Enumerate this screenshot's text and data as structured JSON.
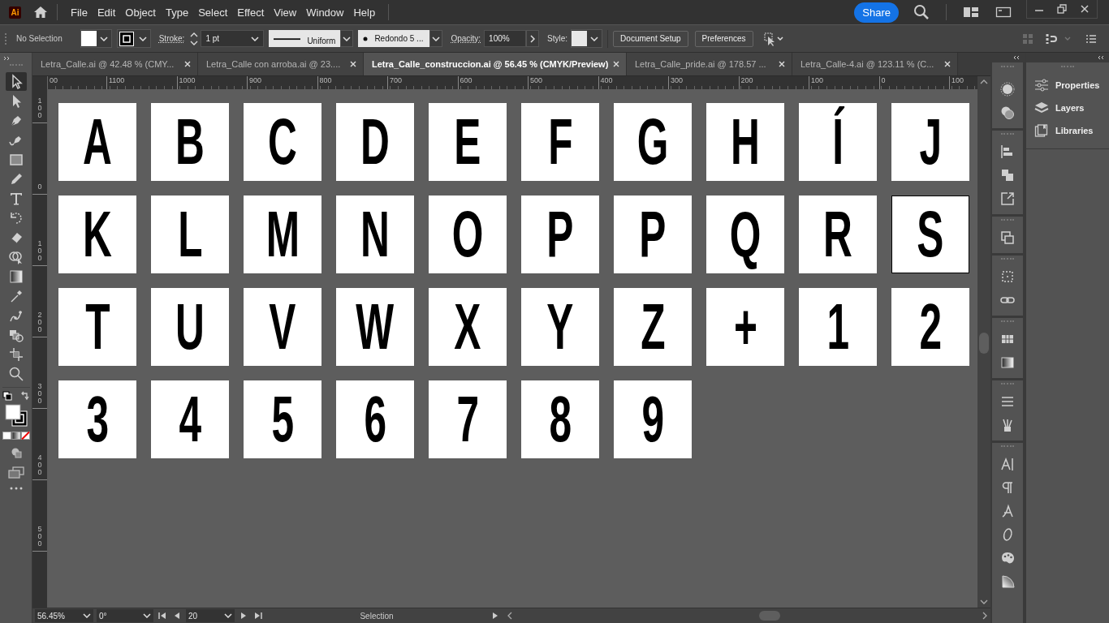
{
  "logo": "Ai",
  "menu": [
    "File",
    "Edit",
    "Object",
    "Type",
    "Select",
    "Effect",
    "View",
    "Window",
    "Help"
  ],
  "share": "Share",
  "control_bar": {
    "selection": "No Selection",
    "stroke_label": "Stroke:",
    "stroke_weight": "1 pt",
    "stroke_profile": "Uniform",
    "brush": "Redondo 5 ...",
    "opacity_label": "Opacity:",
    "opacity": "100%",
    "style_label": "Style:",
    "buttons": [
      "Document Setup",
      "Preferences"
    ]
  },
  "tabs": [
    {
      "label": "Letra_Calle.ai @ 42.48 % (CMY...",
      "selected": false
    },
    {
      "label": "Letra_Calle con arroba.ai @ 23....",
      "selected": false
    },
    {
      "label": "Letra_Calle_construccion.ai @ 56.45 % (CMYK/Preview)",
      "selected": true
    },
    {
      "label": "Letra_Calle_pride.ai @ 178.57 ...",
      "selected": false
    },
    {
      "label": "Letra_Calle-4.ai @ 123.11 % (C...",
      "selected": false
    }
  ],
  "tools": [
    {
      "kind": "selection",
      "selected": true
    },
    {
      "kind": "direct",
      "selected": false
    },
    {
      "kind": "pen",
      "selected": false
    },
    {
      "kind": "curvature",
      "selected": false
    },
    {
      "kind": "rectangle",
      "selected": false
    },
    {
      "kind": "pencil",
      "selected": false
    },
    {
      "kind": "type",
      "selected": false
    },
    {
      "kind": "rotate",
      "selected": false
    },
    {
      "kind": "eraser",
      "selected": false
    },
    {
      "kind": "shapebuilder",
      "selected": false
    },
    {
      "kind": "gradient",
      "selected": false
    },
    {
      "kind": "eyedropper",
      "selected": false
    },
    {
      "kind": "puppet",
      "selected": false
    },
    {
      "kind": "livepaint",
      "selected": false
    },
    {
      "kind": "artboard",
      "selected": false
    },
    {
      "kind": "zoom",
      "selected": false
    }
  ],
  "rulers": {
    "horizontal": [
      "00",
      "1100",
      "1000",
      "900",
      "800",
      "700",
      "600",
      "500",
      "400",
      "300",
      "200",
      "100",
      "0",
      "100"
    ],
    "vertical": [
      "100",
      "0",
      "100",
      "200",
      "300",
      "400",
      "500"
    ]
  },
  "artboards": [
    {
      "glyph": "A",
      "selected": false
    },
    {
      "glyph": "B",
      "selected": false
    },
    {
      "glyph": "C",
      "selected": false
    },
    {
      "glyph": "D",
      "selected": false
    },
    {
      "glyph": "E",
      "selected": false
    },
    {
      "glyph": "F",
      "selected": false
    },
    {
      "glyph": "G",
      "selected": false
    },
    {
      "glyph": "H",
      "selected": false
    },
    {
      "glyph": "Í",
      "selected": false
    },
    {
      "glyph": "J",
      "selected": false
    },
    {
      "glyph": "K",
      "selected": false
    },
    {
      "glyph": "L",
      "selected": false
    },
    {
      "glyph": "M",
      "selected": false
    },
    {
      "glyph": "N",
      "selected": false
    },
    {
      "glyph": "O",
      "selected": false
    },
    {
      "glyph": "P",
      "selected": false
    },
    {
      "glyph": "P",
      "selected": false
    },
    {
      "glyph": "Q",
      "selected": false
    },
    {
      "glyph": "R",
      "selected": false
    },
    {
      "glyph": "S",
      "selected": true
    },
    {
      "glyph": "T",
      "selected": false
    },
    {
      "glyph": "U",
      "selected": false
    },
    {
      "glyph": "V",
      "selected": false
    },
    {
      "glyph": "W",
      "selected": false
    },
    {
      "glyph": "X",
      "selected": false
    },
    {
      "glyph": "Y",
      "selected": false
    },
    {
      "glyph": "Z",
      "selected": false
    },
    {
      "glyph": "+",
      "selected": false
    },
    {
      "glyph": "1",
      "selected": false
    },
    {
      "glyph": "2",
      "selected": false
    },
    {
      "glyph": "3",
      "selected": false
    },
    {
      "glyph": "4",
      "selected": false
    },
    {
      "glyph": "5",
      "selected": false
    },
    {
      "glyph": "6",
      "selected": false
    },
    {
      "glyph": "7",
      "selected": false
    },
    {
      "glyph": "8",
      "selected": false
    },
    {
      "glyph": "9",
      "selected": false
    }
  ],
  "panels": [
    "Properties",
    "Layers",
    "Libraries"
  ],
  "status_bar": {
    "zoom": "56.45%",
    "rotation": "0°",
    "artboard": "20",
    "tool": "Selection"
  }
}
